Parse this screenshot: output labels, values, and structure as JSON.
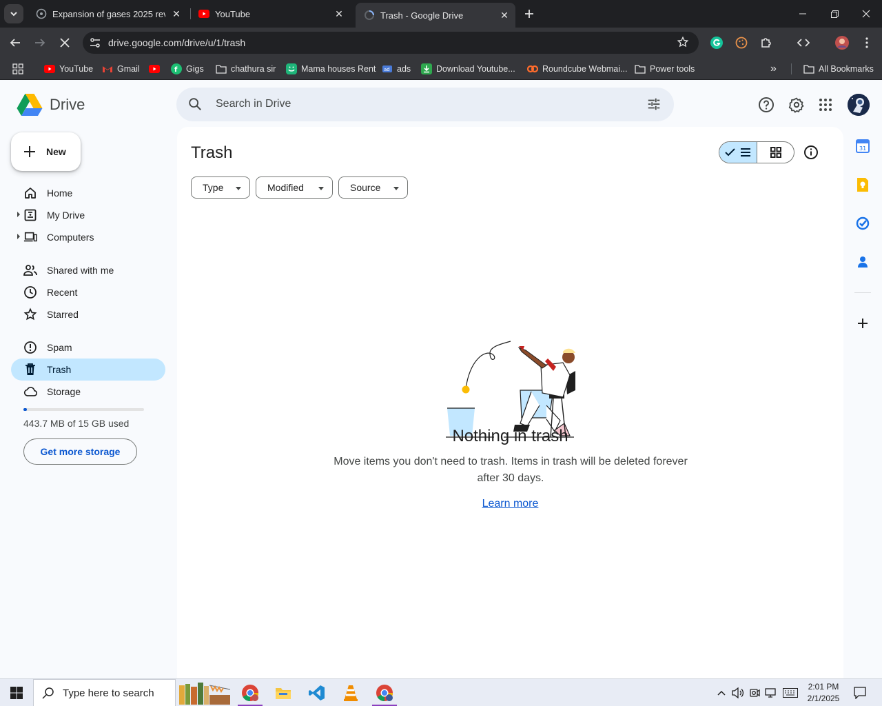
{
  "browser": {
    "tabs": [
      {
        "title": "Expansion of gases 2025 revisio"
      },
      {
        "title": "YouTube"
      },
      {
        "title": "Trash - Google Drive"
      }
    ],
    "url": "drive.google.com/drive/u/1/trash",
    "bookmarks": [
      {
        "label": "YouTube"
      },
      {
        "label": "Gmail"
      },
      {
        "label": ""
      },
      {
        "label": "Gigs"
      },
      {
        "label": "chathura sir"
      },
      {
        "label": "Mama houses Rent"
      },
      {
        "label": "ads"
      },
      {
        "label": "Download Youtube..."
      },
      {
        "label": "Roundcube Webmai..."
      },
      {
        "label": "Power tools"
      }
    ],
    "all_bookmarks": "All Bookmarks",
    "overflow": "»"
  },
  "drive": {
    "logo_text": "Drive",
    "search_placeholder": "Search in Drive",
    "new_label": "New",
    "nav": [
      {
        "label": "Home"
      },
      {
        "label": "My Drive"
      },
      {
        "label": "Computers"
      },
      {
        "label": "Shared with me"
      },
      {
        "label": "Recent"
      },
      {
        "label": "Starred"
      },
      {
        "label": "Spam"
      },
      {
        "label": "Trash"
      },
      {
        "label": "Storage"
      }
    ],
    "storage_used_fraction": 0.029,
    "storage_text": "443.7 MB of 15 GB used",
    "get_more_storage": "Get more storage",
    "page_title": "Trash",
    "filters": [
      {
        "label": "Type"
      },
      {
        "label": "Modified"
      },
      {
        "label": "Source"
      }
    ],
    "empty_title": "Nothing in trash",
    "empty_desc": "Move items you don't need to trash. Items in trash will be deleted forever after 30 days.",
    "learn_more": "Learn more",
    "calendar_day": "31"
  },
  "taskbar": {
    "search_placeholder": "Type here to search",
    "time": "2:01 PM",
    "date": "2/1/2025"
  },
  "colors": {
    "accent": "#0b57d0",
    "selected_nav": "#c2e7ff",
    "chrome_dark": "#35363a"
  }
}
